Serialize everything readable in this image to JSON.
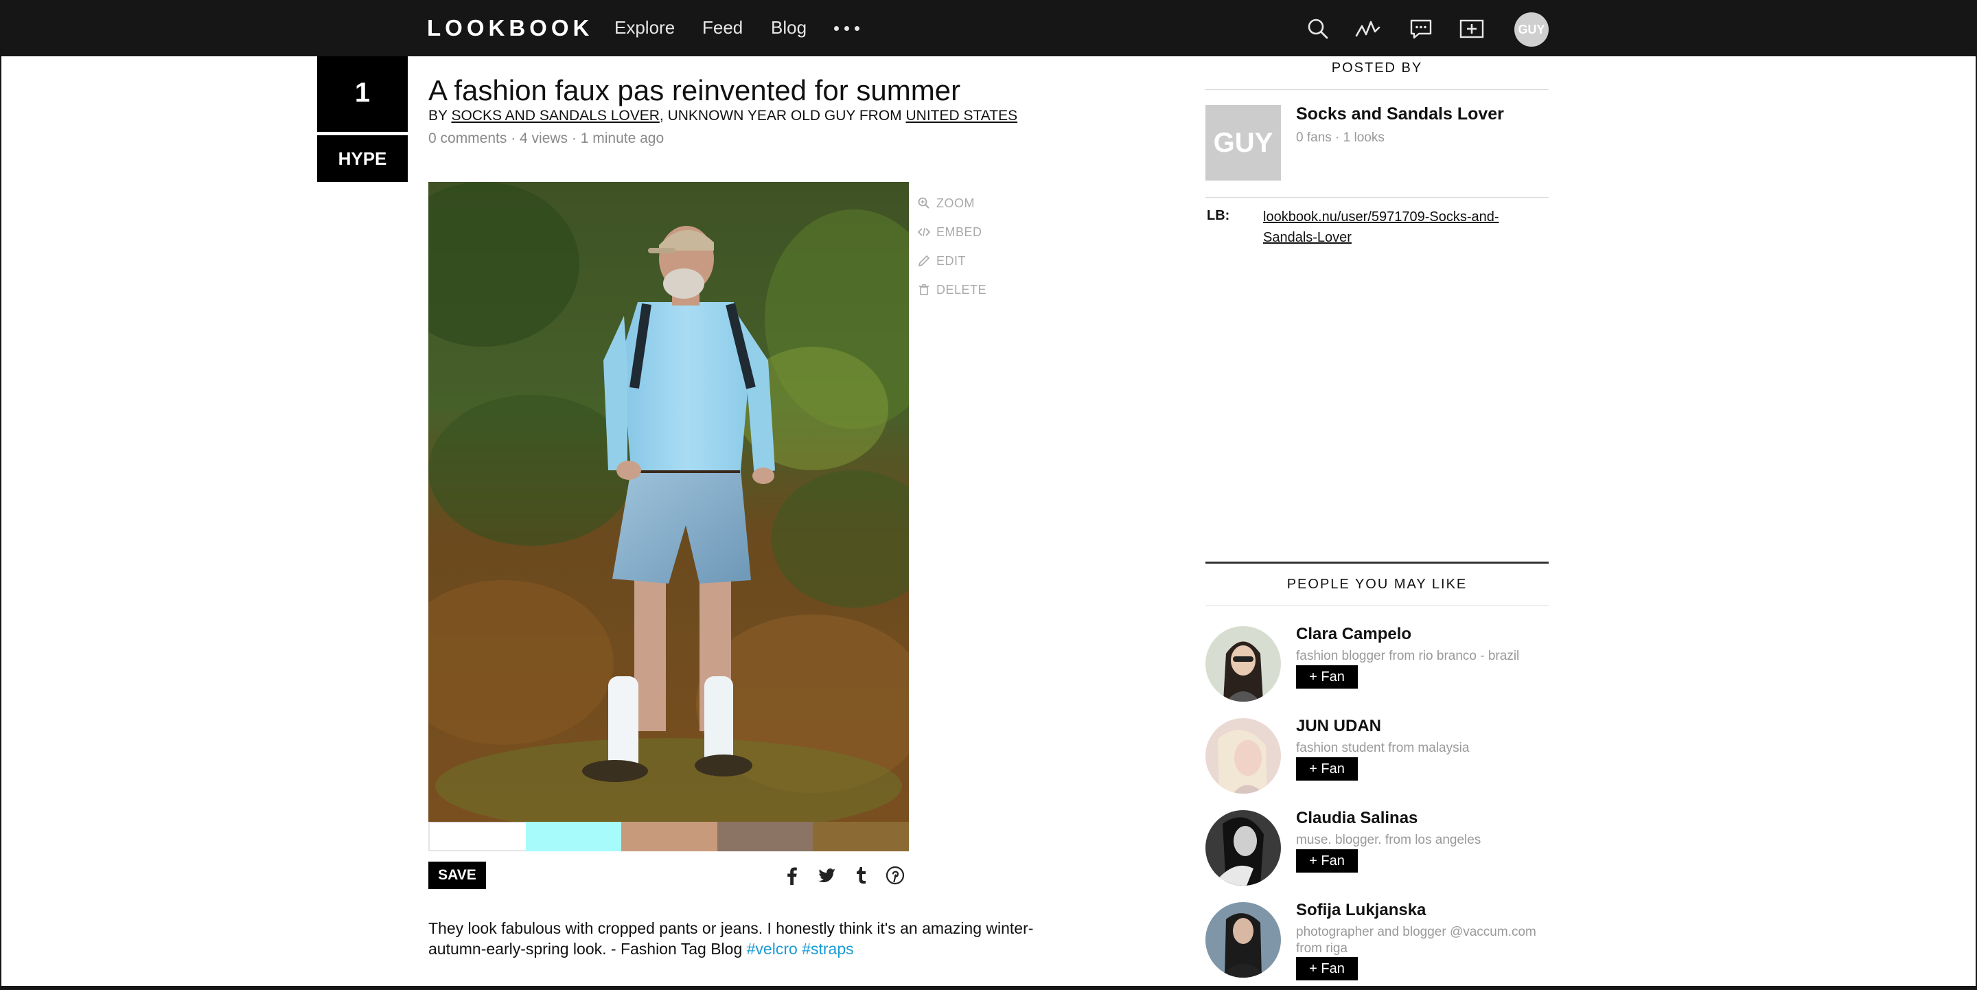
{
  "nav": {
    "logo": "LOOKBOOK",
    "links": [
      "Explore",
      "Feed",
      "Blog"
    ],
    "avatar_label": "GUY"
  },
  "look": {
    "hype_count": "1",
    "hype_label": "HYPE",
    "title": "A fashion faux pas reinvented for summer",
    "byline": {
      "prefix": "BY ",
      "author": "SOCKS AND SANDALS LOVER",
      "middle": ", UNKNOWN YEAR OLD GUY FROM ",
      "country": "UNITED STATES"
    },
    "meta": "0 comments · 4 views · 1 minute ago",
    "actions": [
      "ZOOM",
      "EMBED",
      "EDIT",
      "DELETE"
    ],
    "palette": [
      "#ffffff",
      "#a7fbfb",
      "#c79a7c",
      "#8b7464",
      "#8b6b33"
    ],
    "save_label": "SAVE",
    "description": "They look fabulous with cropped pants or jeans. I honestly think it's an amazing winter-autumn-early-spring look. - Fashion Tag Blog ",
    "tags": [
      "#velcro",
      "#straps"
    ]
  },
  "posted_by": {
    "heading": "POSTED BY",
    "thumb_label": "GUY",
    "name": "Socks and Sandals Lover",
    "stats": "0 fans · 1 looks",
    "lb_label": "LB:",
    "lb_url": "lookbook.nu/user/5971709-Socks-and-Sandals-Lover"
  },
  "suggestions": {
    "heading": "PEOPLE YOU MAY LIKE",
    "fan_label": "+ Fan",
    "people": [
      {
        "name": "Clara Campelo",
        "desc": "fashion blogger from rio branco - brazil"
      },
      {
        "name": "JUN UDAN",
        "desc": "fashion student from malaysia"
      },
      {
        "name": "Claudia Salinas",
        "desc": "muse. blogger. from los angeles"
      },
      {
        "name": "Sofija Lukjanska",
        "desc": "photographer and blogger @vaccum.com from riga"
      }
    ]
  }
}
